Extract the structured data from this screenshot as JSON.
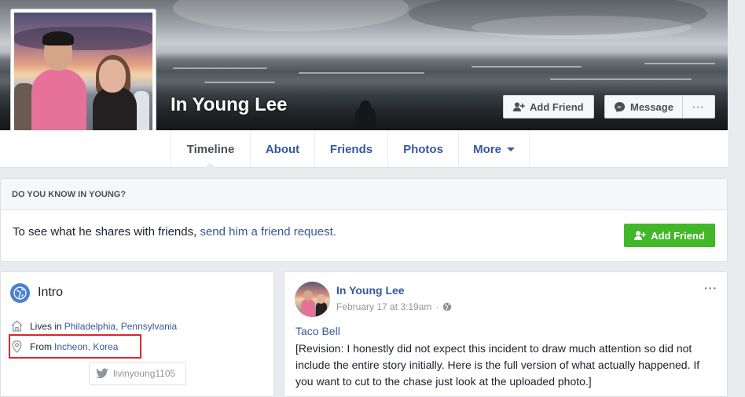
{
  "profile": {
    "name": "In Young Lee"
  },
  "header_buttons": {
    "add_friend": "Add Friend",
    "message": "Message",
    "more": "···"
  },
  "nav": {
    "tabs": [
      "Timeline",
      "About",
      "Friends",
      "Photos",
      "More"
    ],
    "active": "Timeline"
  },
  "know_box": {
    "heading": "DO YOU KNOW IN YOUNG?",
    "text": "To see what he shares with friends,",
    "link": "send him a friend request.",
    "button": "Add Friend"
  },
  "intro": {
    "title": "Intro",
    "lives_prefix": "Lives in",
    "lives_link": "Philadelphia, Pennsylvania",
    "from_prefix": "From",
    "from_link": "Incheon, Korea",
    "twitter_handle": "livinyoung1105"
  },
  "post": {
    "author": "In Young Lee",
    "date": "February 17 at 3:19am",
    "dot": "·",
    "menu": "···",
    "link_text": "Taco Bell",
    "body": "[Revision: I honestly did not expect this incident to draw much attention so did not include the entire story initially. Here is the full version of what actually happened. If you want to cut to the chase just look at the uploaded photo.]"
  },
  "colors": {
    "link_blue": "#365899",
    "green_button": "#42b72a",
    "highlight_red": "#d9292e",
    "page_bg": "#e9ebee"
  },
  "icons": [
    "add-friend-icon",
    "messenger-icon",
    "globe-icon",
    "home-icon",
    "location-pin-icon",
    "twitter-icon",
    "public-globe-icon"
  ]
}
